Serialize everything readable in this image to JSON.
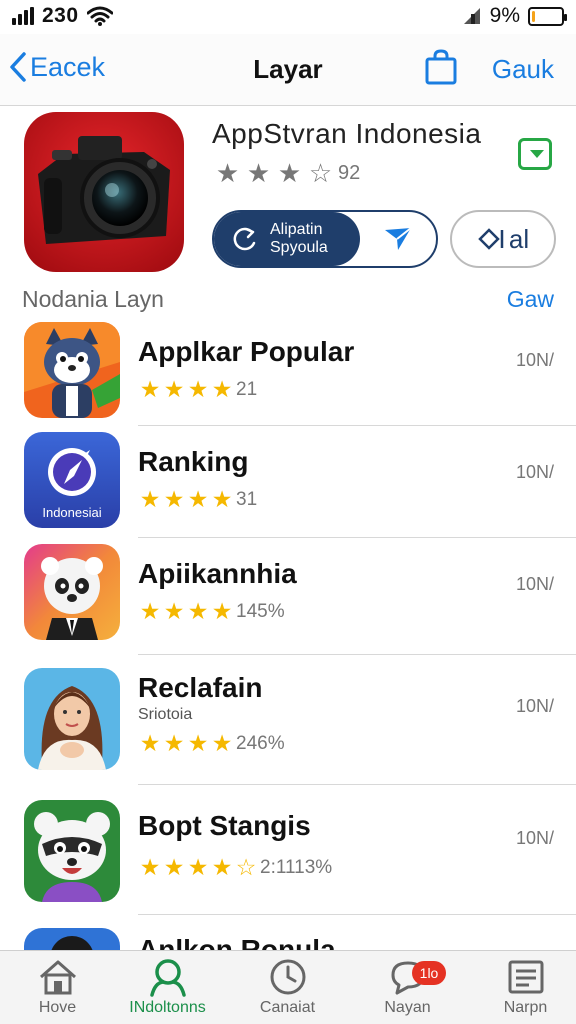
{
  "status": {
    "time": "230",
    "battery": "9%",
    "battery_level": 0.12
  },
  "nav": {
    "back_label": "Eacek",
    "title": "Layar",
    "right_label": "Gauk"
  },
  "featured": {
    "title": "AppStvran Indonesia",
    "rating_text": "92",
    "stars": 3,
    "install_label_line1": "Alipatin",
    "install_label_line2": "Spyoula",
    "share_label": "al"
  },
  "section": {
    "title": "Nodania Layn",
    "link": "Gaw"
  },
  "apps": [
    {
      "name": "Applkar Popular",
      "subtitle": "",
      "rating_text": "21",
      "stars": 4,
      "size": "10N/",
      "icon": "cat-mascot-icon"
    },
    {
      "name": "Ranking",
      "subtitle": "",
      "rating_text": "31",
      "stars": 4,
      "size": "10N/",
      "icon": "compass-icon",
      "icon_label": "Indonesiai"
    },
    {
      "name": "Apiikannhia",
      "subtitle": "",
      "rating_text": "145%",
      "stars": 4,
      "size": "10N/",
      "icon": "panda-icon"
    },
    {
      "name": "Reclafain",
      "subtitle": "Sriotoia",
      "rating_text": "246%",
      "stars": 4,
      "size": "10N/",
      "icon": "woman-portrait-icon"
    },
    {
      "name": "Bopt Stangis",
      "subtitle": "",
      "rating_text": "2:1113%",
      "stars": 4.5,
      "size": "10N/",
      "icon": "raccoon-icon"
    },
    {
      "name": "Anlkon Ronula",
      "subtitle": "",
      "rating_text": "",
      "stars": 0,
      "size": "",
      "icon": "avatar-icon"
    }
  ],
  "tabs": [
    {
      "label": "Hove",
      "active": false,
      "icon": "home-icon"
    },
    {
      "label": "INdoltonns",
      "active": true,
      "icon": "person-icon"
    },
    {
      "label": "Canaiat",
      "active": false,
      "icon": "clock-icon"
    },
    {
      "label": "Nayan",
      "active": false,
      "icon": "chat-icon",
      "badge": "1lo"
    },
    {
      "label": "Narpn",
      "active": false,
      "icon": "list-icon"
    }
  ],
  "colors": {
    "accent": "#1a7de0",
    "active_tab": "#1b8f4a",
    "star": "#f5b800",
    "install": "#1f3e6b",
    "badge": "#e53223"
  }
}
